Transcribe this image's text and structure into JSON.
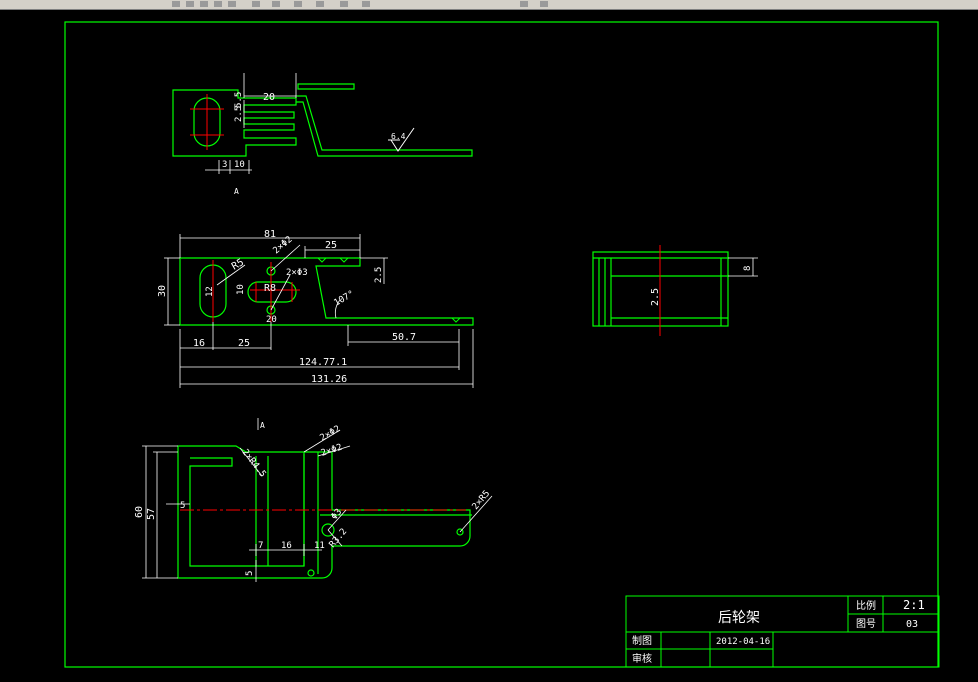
{
  "title_block": {
    "part_name": "后轮架",
    "scale_label": "比例",
    "scale_value": "2:1",
    "drawing_no_label": "图号",
    "drawing_no_value": "03",
    "drawn_label": "制图",
    "drawn_date": "2012-04-16",
    "checked_label": "审核"
  },
  "top_view": {
    "dim_20": "20",
    "dim_5_5": "5.5",
    "dim_2_5": "2.5",
    "dim_3": "3",
    "dim_10": "10",
    "roughness": "6.4",
    "section_mark": "A"
  },
  "front_view": {
    "dim_81": "81",
    "dim_2xphi2": "2×Φ2",
    "dim_25_top": "25",
    "dim_r5": "R5",
    "dim_2xphi3": "2×Φ3",
    "dim_30": "30",
    "dim_12": "12",
    "dim_10": "10",
    "dim_r8": "R8",
    "dim_20": "20",
    "dim_2_5": "2.5",
    "angle": "107°",
    "dim_16": "16",
    "dim_25": "25",
    "dim_50_7": "50.7",
    "dim_124_771": "124.77.1",
    "dim_131_26": "131.26"
  },
  "side_view": {
    "dim_8": "8",
    "dim_2_5": "2.5"
  },
  "bottom_view": {
    "section_mark": "A",
    "dim_2xphi2_a": "2×Φ2",
    "dim_2xphi2_b": "2×Φ2",
    "dim_2xr4_5": "2×R4.5",
    "dim_60": "60",
    "dim_57": "57",
    "dim_5_left": "5",
    "dim_phi3": "Φ3",
    "dim_2xr5": "2×R5",
    "dim_r3_2": "R3.2",
    "dim_7": "7",
    "dim_16": "16",
    "dim_11": "11",
    "dim_5_bottom": "5"
  },
  "colors": {
    "background": "#000000",
    "part_lines": "#00ff00",
    "dimension_lines": "#ffffff",
    "center_lines": "#ff0000",
    "border": "#00ff00"
  }
}
